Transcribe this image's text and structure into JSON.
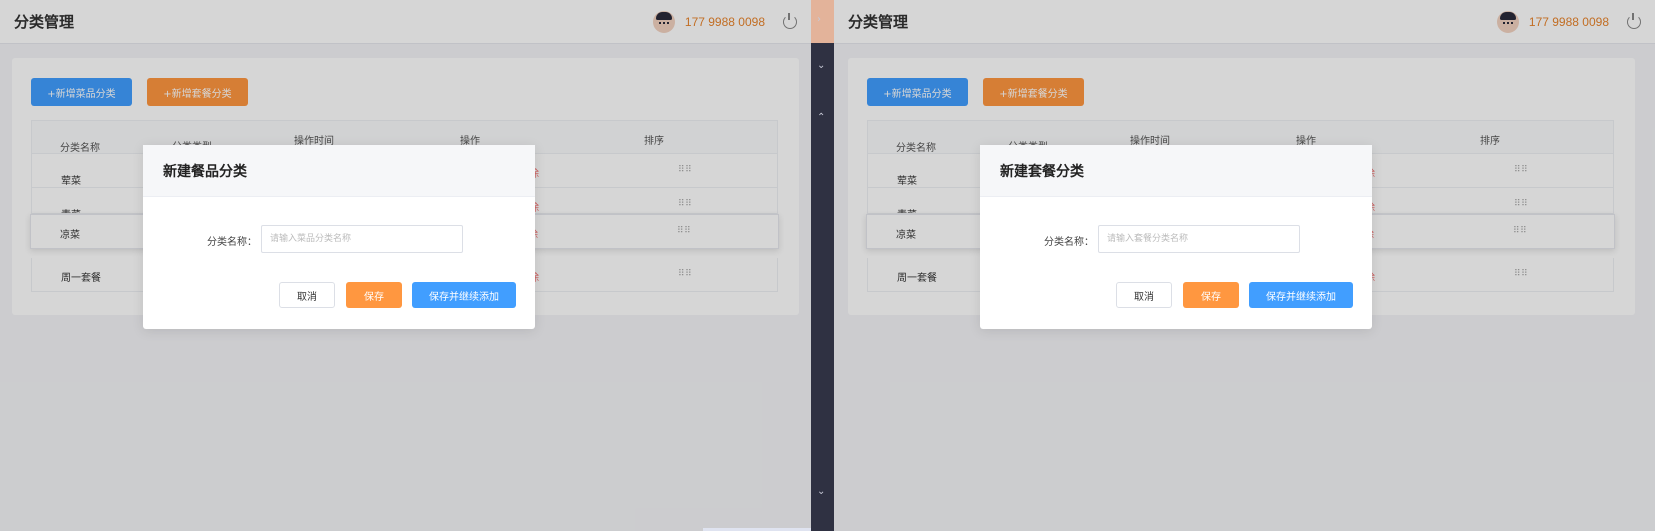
{
  "left": {
    "header": {
      "title": "分类管理",
      "phone": "177 9988 0098"
    },
    "buttons": {
      "add_dish_category": "+新增菜品分类",
      "add_combo_category": "+新增套餐分类"
    },
    "table": {
      "columns": [
        "分类名称",
        "分类类型",
        "操作时间",
        "操作",
        "排序"
      ],
      "rows": [
        {
          "name": "荤菜",
          "op": "除",
          "drag": "⠿⠿"
        },
        {
          "name": "素菜",
          "op": "除",
          "drag": "⠿⠿"
        },
        {
          "name": "凉菜",
          "op": "除",
          "drag": "⠿⠿"
        },
        {
          "name": "周一套餐",
          "op": "除",
          "drag": "⠿⠿"
        }
      ]
    },
    "dialog": {
      "title": "新建餐品分类",
      "label": "分类名称：",
      "placeholder": "请输入菜品分类名称",
      "cancel": "取消",
      "save": "保存",
      "save_continue": "保存并继续添加"
    }
  },
  "right": {
    "header": {
      "title": "分类管理",
      "phone": "177 9988 0098"
    },
    "buttons": {
      "add_dish_category": "+新增菜品分类",
      "add_combo_category": "+新增套餐分类"
    },
    "table": {
      "columns": [
        "分类名称",
        "分类类型",
        "操作时间",
        "操作",
        "排序"
      ],
      "rows": [
        {
          "name": "荤菜",
          "op": "除",
          "drag": "⠿⠿"
        },
        {
          "name": "素菜",
          "op": "除",
          "drag": "⠿⠿"
        },
        {
          "name": "凉菜",
          "op": "除",
          "drag": "⠿⠿"
        },
        {
          "name": "周一套餐",
          "op": "除",
          "drag": "⠿⠿"
        }
      ]
    },
    "dialog": {
      "title": "新建套餐分类",
      "label": "分类名称：",
      "placeholder": "请输入套餐分类名称",
      "cancel": "取消",
      "save": "保存",
      "save_continue": "保存并继续添加"
    }
  },
  "colors": {
    "accent_blue": "#419eff",
    "accent_orange": "#ff9740",
    "phone_text": "#e8842c",
    "delete_red": "#f56c6c",
    "sidebar_dark": "#2f3142"
  }
}
